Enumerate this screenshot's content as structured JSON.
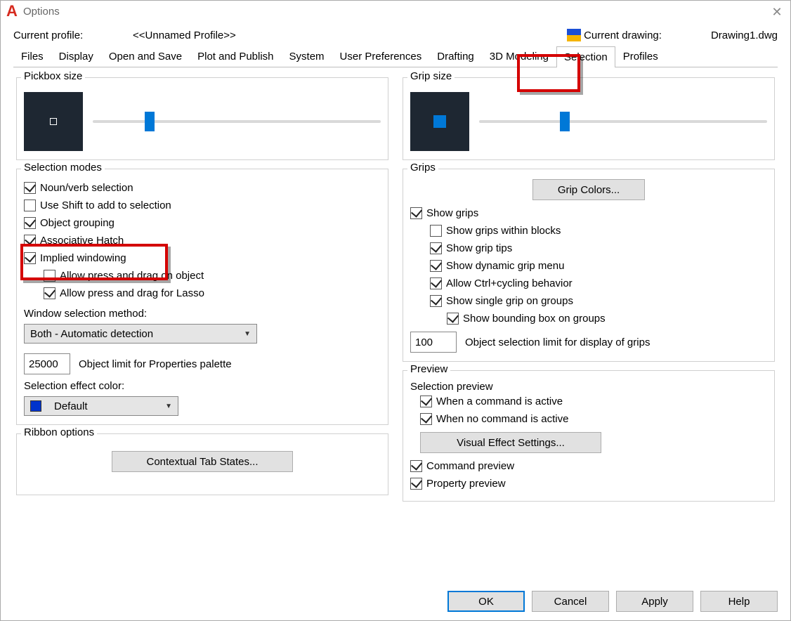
{
  "window": {
    "title": "Options"
  },
  "profile": {
    "label": "Current profile:",
    "value": "<<Unnamed Profile>>",
    "drawing_label": "Current drawing:",
    "drawing_value": "Drawing1.dwg"
  },
  "tabs": {
    "files": "Files",
    "display": "Display",
    "open_and_save": "Open and Save",
    "plot_and_publish": "Plot and Publish",
    "system": "System",
    "user_preferences": "User Preferences",
    "drafting": "Drafting",
    "modeling": "3D Modeling",
    "selection": "Selection",
    "profiles": "Profiles",
    "active": "Selection"
  },
  "left": {
    "pickbox_title": "Pickbox size",
    "selection_modes_title": "Selection modes",
    "selection_modes": {
      "noun_verb": {
        "label": "Noun/verb selection",
        "checked": true
      },
      "shift_add": {
        "label": "Use Shift to add to selection",
        "checked": false
      },
      "obj_grouping": {
        "label": "Object grouping",
        "checked": true
      },
      "assoc_hatch": {
        "label": "Associative Hatch",
        "checked": true
      },
      "implied_window": {
        "label": "Implied windowing",
        "checked": true
      },
      "press_drag_obj": {
        "label": "Allow press and drag on object",
        "checked": false
      },
      "press_drag_lasso": {
        "label": "Allow press and drag for Lasso",
        "checked": true
      }
    },
    "window_sel_method_label": "Window selection method:",
    "window_sel_method_value": "Both - Automatic detection",
    "obj_limit_value": "25000",
    "obj_limit_label": "Object limit for Properties palette",
    "effect_color_label": "Selection effect color:",
    "effect_color_value": "Default",
    "ribbon_title": "Ribbon options",
    "contextual_btn": "Contextual Tab States..."
  },
  "right": {
    "grip_size_title": "Grip size",
    "grips_title": "Grips",
    "grip_colors_btn": "Grip Colors...",
    "grips": {
      "show_grips": {
        "label": "Show grips",
        "checked": true
      },
      "within_blocks": {
        "label": "Show grips within blocks",
        "checked": false
      },
      "grip_tips": {
        "label": "Show grip tips",
        "checked": true
      },
      "dynamic_menu": {
        "label": "Show dynamic grip menu",
        "checked": true
      },
      "ctrl_cycle": {
        "label": "Allow Ctrl+cycling behavior",
        "checked": true
      },
      "single_group": {
        "label": "Show single grip on groups",
        "checked": true
      },
      "bbox_group": {
        "label": "Show bounding box on groups",
        "checked": true
      }
    },
    "sel_limit_value": "100",
    "sel_limit_label": "Object selection limit for display of grips",
    "preview_title": "Preview",
    "sel_preview_label": "Selection preview",
    "when_cmd_active": {
      "label": "When a command is active",
      "checked": true
    },
    "when_no_cmd": {
      "label": "When no command is active",
      "checked": true
    },
    "visual_effect_btn": "Visual Effect Settings...",
    "command_preview": {
      "label": "Command preview",
      "checked": true
    },
    "property_preview": {
      "label": "Property preview",
      "checked": true
    }
  },
  "buttons": {
    "ok": "OK",
    "cancel": "Cancel",
    "apply": "Apply",
    "help": "Help"
  }
}
